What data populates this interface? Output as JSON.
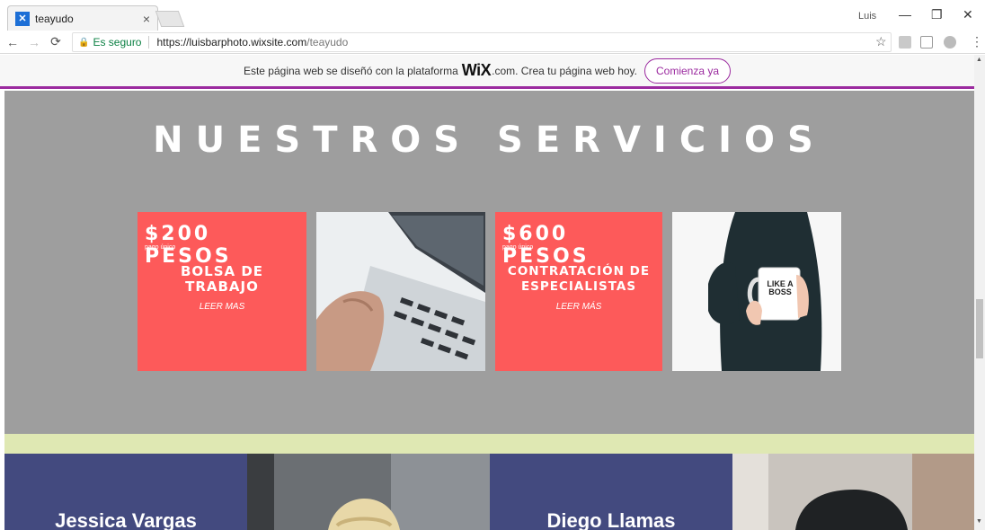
{
  "browser": {
    "tab_title": "teayudo",
    "tab_close": "×",
    "user_label": "Luis",
    "secure_label": "Es seguro",
    "url_host": "https://luisbarphoto.wixsite.com",
    "url_path": "/teayudo",
    "window_controls": [
      "—",
      "❐",
      "✕"
    ]
  },
  "wix_banner": {
    "text_before": "Este página web se diseñó con la plataforma",
    "logo": "WiX",
    "text_after": ".com. Crea tu página web hoy.",
    "button_label": "Comienza ya",
    "accent_color": "#9b2a9f"
  },
  "services": {
    "title": "NUESTROS SERVICIOS",
    "background_color": "#9e9e9e",
    "cards": [
      {
        "price": "$200 PESOS",
        "sub": "pago único",
        "name_line1": "BOLSA DE",
        "name_line2": "TRABAJO",
        "more": "LEER MAS",
        "color": "#fd5a5a"
      },
      {
        "price": "$600 PESOS",
        "sub": "pago único",
        "name_line1": "CONTRATACIÓN DE",
        "name_line2": "ESPECIALISTAS",
        "more": "LEER MÁS",
        "color": "#fd5a5a"
      }
    ],
    "photos": [
      "laptop-photo",
      "mug-photo"
    ],
    "mug_text": "LIKE A BOSS"
  },
  "team": {
    "members": [
      "Jessica Vargas",
      "Diego Llamas"
    ],
    "block_color": "#434a7f",
    "strip_color": "#dfe8b3"
  }
}
